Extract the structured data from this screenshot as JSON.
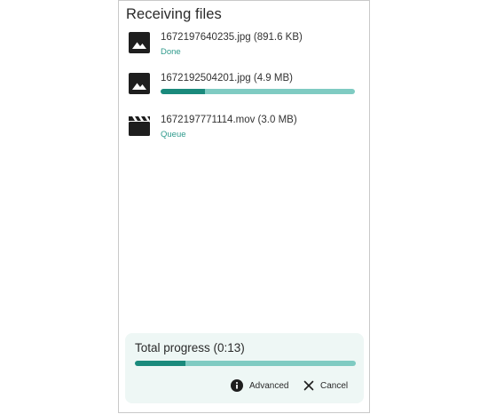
{
  "header": {
    "title": "Receiving files"
  },
  "files": [
    {
      "name": "1672197640235.jpg (891.6 KB)",
      "status": "Done",
      "icon": "image-icon",
      "progress": 1.0
    },
    {
      "name": "1672192504201.jpg (4.9 MB)",
      "status": "",
      "icon": "image-icon",
      "progress": 0.23
    },
    {
      "name": "1672197771114.mov (3.0 MB)",
      "status": "Queue",
      "icon": "movie-icon",
      "progress": 0
    }
  ],
  "total": {
    "title": "Total progress (0:13)",
    "progress": 0.23,
    "advanced_label": "Advanced",
    "cancel_label": "Cancel"
  },
  "colors": {
    "accent": "#1a8a7c",
    "accent_light": "#7fcbc2",
    "status_text": "#2f9a8c",
    "card_background": "#eef7f5"
  }
}
